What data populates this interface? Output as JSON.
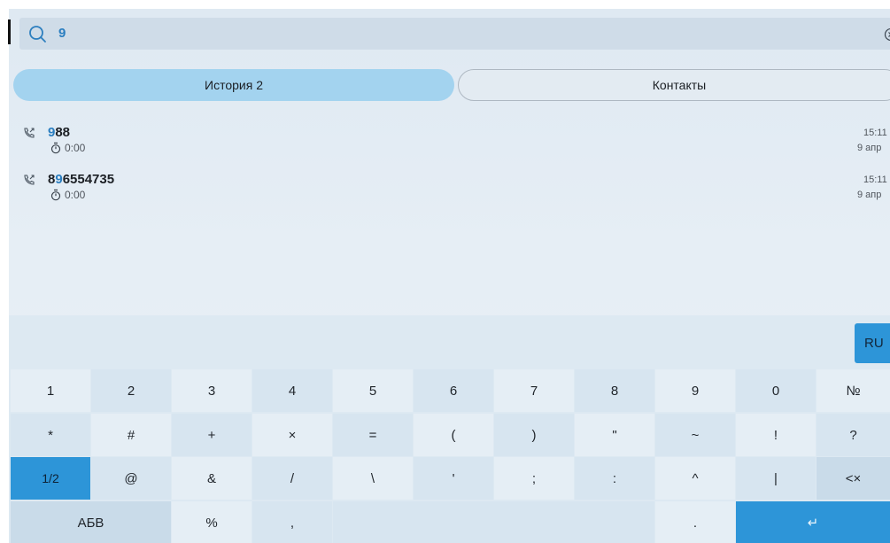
{
  "search": {
    "value": "9"
  },
  "tabs": [
    {
      "label": "История 2",
      "active": true
    },
    {
      "label": "Контакты",
      "active": false
    }
  ],
  "calls": [
    {
      "prefix": "",
      "match": "9",
      "suffix": "88",
      "duration": "0:00",
      "time": "15:11",
      "date": "9 апр"
    },
    {
      "prefix": "8",
      "match": "9",
      "suffix": "6554735",
      "duration": "0:00",
      "time": "15:11",
      "date": "9 апр"
    }
  ],
  "keyboard": {
    "lang": "RU",
    "row1": [
      "1",
      "2",
      "3",
      "4",
      "5",
      "6",
      "7",
      "8",
      "9",
      "0",
      "№"
    ],
    "row2": [
      "*",
      "#",
      "+",
      "×",
      "=",
      "(",
      ")",
      "\"",
      "~",
      "!",
      "?"
    ],
    "row3": [
      "1/2",
      "@",
      "&",
      "/",
      "\\",
      "'",
      ";",
      ":",
      "^",
      "|",
      "<×"
    ],
    "row4": [
      "АБВ",
      "%",
      ",",
      "",
      ".",
      "↵"
    ]
  },
  "colors": {
    "accent": "#2d95d8",
    "highlight": "#2a7ec0",
    "tab_active": "#a3d3ef"
  }
}
